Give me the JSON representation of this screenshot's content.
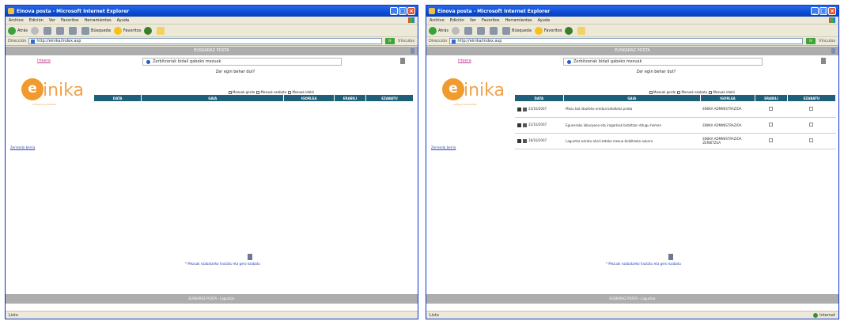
{
  "left": {
    "window_title": "Einova posta - Microsoft Internet Explorer",
    "menu": [
      "Archivo",
      "Edición",
      "Ver",
      "Favoritos",
      "Herramientas",
      "Ayuda"
    ],
    "toolbar": {
      "back": "Atrás",
      "search": "Búsqueda",
      "favorites": "Favoritos"
    },
    "address": {
      "label": "Dirección",
      "url": "http://einika/index.asp",
      "go": "Ir",
      "links": "Vínculos"
    },
    "topbar": "EUSKARAZ POSTA",
    "sidelink": "Irteera",
    "search_placeholder": "Zerbitzariak bidali gabeko mezuak",
    "help": "Zer egin behar dut?",
    "logo": {
      "letter": "e",
      "word": "inika",
      "tagline": "software kudeaketa"
    },
    "options": [
      "Mezuak gorde",
      "Mezuak ezabatu",
      "Mezuak idatzi"
    ],
    "leftlink": "Zerrenda berria",
    "columns": [
      "DATA",
      "GAIA",
      "IGORLEA",
      "ERABILI",
      "EZABATU"
    ],
    "rows": [],
    "footer_text": "* Mezuak ezabatzeko hautatu eta gero ezabatu",
    "bottombar": "EUSKARAZ POSTA - Laguntza"
  },
  "right": {
    "window_title": "Einova posta - Microsoft Internet Explorer",
    "menu": [
      "Archivo",
      "Edición",
      "Ver",
      "Favoritos",
      "Herramientas",
      "Ayuda"
    ],
    "toolbar": {
      "back": "Atrás",
      "search": "Búsqueda",
      "favorites": "Favoritos"
    },
    "address": {
      "label": "Dirección",
      "url": "http://einika/index.asp",
      "go": "Ir",
      "links": "Vínculos"
    },
    "topbar": "EUSKARAZ POSTA",
    "sidelink": "Irteera",
    "search_placeholder": "Zerbitzariak bidali gabeko mezuak",
    "help": "Zer egin behar dut?",
    "logo": {
      "letter": "e",
      "word": "inika",
      "tagline": "software kudeaketa"
    },
    "options": [
      "Mezuak gorde",
      "Mezuak ezabatu",
      "Mezuak idatzi"
    ],
    "leftlink": "Zerrenda berria",
    "columns": [
      "DATA",
      "GAIA",
      "IGORLEA",
      "ERABILI",
      "EZABATU"
    ],
    "rows": [
      {
        "date": "23/10/2007",
        "subject": "Mezu bat idazteko eredua bidalketa proba",
        "sender": "EINIKA ADMINISTRAZIOA"
      },
      {
        "date": "22/10/2007",
        "subject": "Egunerako laburpena eta iragarkiak bidaltzen ditugu hemen",
        "sender": "EINIKA ADMINISTRAZIOA"
      },
      {
        "date": "18/10/2007",
        "subject": "Laguntza eskatu ahal izateko mezua bidaltzeko aukera",
        "sender": "EINIKA ADMINISTRAZIOA ZERBITZUA"
      }
    ],
    "footer_text": "* Mezuak ezabatzeko hautatu eta gero ezabatu",
    "bottombar": "EUSKARAZ POSTA - Laguntza",
    "status": "Internet"
  },
  "left_status": "Listo",
  "right_status": "Listo"
}
